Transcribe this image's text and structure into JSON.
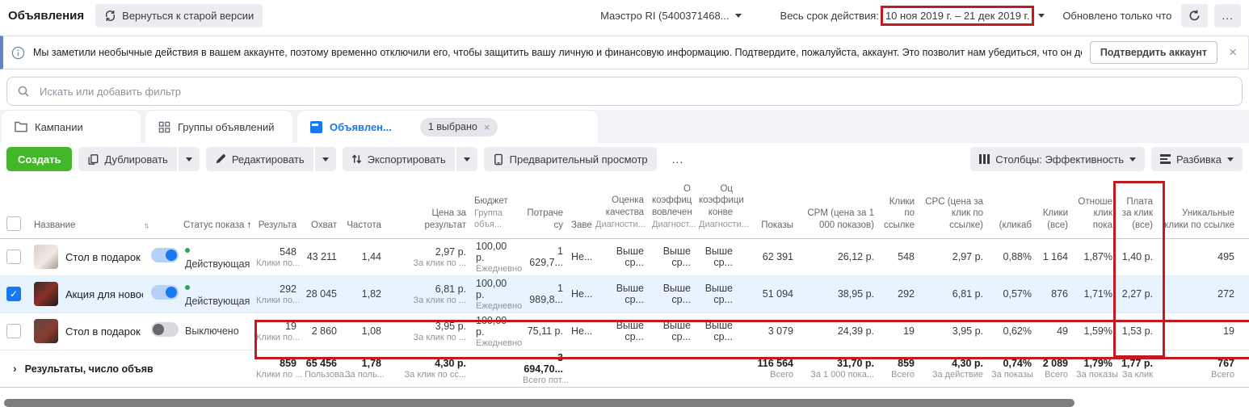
{
  "page": {
    "title": "Объявления",
    "back_button": "Вернуться к старой версии",
    "account": "Маэстро RI (5400371468...",
    "date_label": "Весь срок действия:",
    "date_range": "10 ноя 2019 г. – 21 дек 2019 г.",
    "updated": "Обновлено только что"
  },
  "banner": {
    "text": "Мы заметили необычные действия в вашем аккаунте, поэтому временно отключили его, чтобы защитить вашу личную и финансовую информацию. Подтвердите, пожалуйста, аккаунт. Это позволит нам убедиться, что он действительно принадлежит вам.",
    "confirm_button": "Подтвердить аккаунт"
  },
  "search": {
    "placeholder": "Искать или добавить фильтр"
  },
  "tabs": {
    "campaigns": "Кампании",
    "adsets": "Группы объявлений",
    "ads": "Объявлен...",
    "selected_badge": "1 выбрано"
  },
  "toolbar": {
    "create": "Создать",
    "duplicate": "Дублировать",
    "edit": "Редактировать",
    "export": "Экспортировать",
    "preview": "Предварительный просмотр",
    "columns": "Столбцы: Эффективность",
    "breakdown": "Разбивка"
  },
  "icons": {
    "dots": "...",
    "close": "×",
    "chevron": "›",
    "sort": "↑↓",
    "arrow_up": "↑",
    "check": "✓"
  },
  "colors": {
    "accent_blue": "#1877f2",
    "green": "#42b72a",
    "annotation_red": "#c41a1f",
    "selected_row": "#e7f3ff",
    "status_green": "#31a24c"
  },
  "table": {
    "name_header": "Название",
    "status_header": "Статус показа",
    "columns": [
      {
        "key": "results",
        "label": "Результа"
      },
      {
        "key": "reach",
        "label": "Охват"
      },
      {
        "key": "frequency",
        "label": "Частота"
      },
      {
        "key": "cost_per_result",
        "label": "Цена за результат"
      },
      {
        "key": "budget",
        "label": "Бюджет",
        "sub": "Группа объя...",
        "align": "left"
      },
      {
        "key": "spent",
        "label": "Потраче су"
      },
      {
        "key": "ends",
        "label": "Заве"
      },
      {
        "key": "quality",
        "label": "Оценка качества",
        "sub": "Диагности..."
      },
      {
        "key": "engagement_rate",
        "label": "О коэффиц вовлечен",
        "sub": "Диагност..."
      },
      {
        "key": "conversion_rate",
        "label": "Оц коэффици конве",
        "sub": "Диагности..."
      },
      {
        "key": "impressions",
        "label": "Показы"
      },
      {
        "key": "cpm",
        "label": "CPM (цена за 1 000 показов)"
      },
      {
        "key": "link_clicks",
        "label": "Клики по ссылке"
      },
      {
        "key": "cpc",
        "label": "CPC (цена за клик по ссылке)"
      },
      {
        "key": "ctr",
        "label": "(кликаб"
      },
      {
        "key": "clicks_all",
        "label": "Клики (все)"
      },
      {
        "key": "click_ratio",
        "label": "Отноше клик пока"
      },
      {
        "key": "pay_per_click",
        "label": "Плата за клик (все)"
      },
      {
        "key": "unique_link_clicks",
        "label": "Уникальные клики по ссылке"
      }
    ],
    "rows": [
      {
        "name": "Стол в подарок — Ко...",
        "selected": false,
        "toggle_on": true,
        "status": "Действующая",
        "status_active": true,
        "cells": {
          "results": {
            "v": "548",
            "s": "Клики по..."
          },
          "reach": {
            "v": "43 211"
          },
          "frequency": {
            "v": "1,44"
          },
          "cost_per_result": {
            "v": "2,97 р.",
            "s": "За клик по ..."
          },
          "budget": {
            "v": "100,00 р.",
            "s": "Ежедневно"
          },
          "spent": {
            "v": "1 629,7..."
          },
          "ends": {
            "v": "Не..."
          },
          "quality": {
            "v": "Выше ср..."
          },
          "engagement_rate": {
            "v": "Выше ср..."
          },
          "conversion_rate": {
            "v": "Выше ср..."
          },
          "impressions": {
            "v": "62 391"
          },
          "cpm": {
            "v": "26,12 р."
          },
          "link_clicks": {
            "v": "548"
          },
          "cpc": {
            "v": "2,97 р."
          },
          "ctr": {
            "v": "0,88%"
          },
          "clicks_all": {
            "v": "1 164"
          },
          "click_ratio": {
            "v": "1,87%"
          },
          "pay_per_click": {
            "v": "1,40 р."
          },
          "unique_link_clicks": {
            "v": "495"
          }
        }
      },
      {
        "name": "Акция для новосел...",
        "selected": true,
        "toggle_on": true,
        "status": "Действующая",
        "status_active": true,
        "cells": {
          "results": {
            "v": "292",
            "s": "Клики по..."
          },
          "reach": {
            "v": "28 045"
          },
          "frequency": {
            "v": "1,82"
          },
          "cost_per_result": {
            "v": "6,81 р.",
            "s": "За клик по ..."
          },
          "budget": {
            "v": "100,00 р.",
            "s": "Ежедневно"
          },
          "spent": {
            "v": "1 989,8..."
          },
          "ends": {
            "v": "Не..."
          },
          "quality": {
            "v": "Выше ср..."
          },
          "engagement_rate": {
            "v": "Выше ср..."
          },
          "conversion_rate": {
            "v": "Выше ср..."
          },
          "impressions": {
            "v": "51 094"
          },
          "cpm": {
            "v": "38,95 р."
          },
          "link_clicks": {
            "v": "292"
          },
          "cpc": {
            "v": "6,81 р."
          },
          "ctr": {
            "v": "0,57%"
          },
          "clicks_all": {
            "v": "876"
          },
          "click_ratio": {
            "v": "1,71%"
          },
          "pay_per_click": {
            "v": "2,27 р."
          },
          "unique_link_clicks": {
            "v": "272"
          }
        }
      },
      {
        "name": "Стол в подарок",
        "selected": false,
        "toggle_on": false,
        "status": "Выключено",
        "status_active": false,
        "cells": {
          "results": {
            "v": "19",
            "s": "Клики по..."
          },
          "reach": {
            "v": "2 860"
          },
          "frequency": {
            "v": "1,08"
          },
          "cost_per_result": {
            "v": "3,95 р.",
            "s": "За клик по ..."
          },
          "budget": {
            "v": "100,00 р.",
            "s": "Ежедневно"
          },
          "spent": {
            "v": "75,11 р."
          },
          "ends": {
            "v": "Не..."
          },
          "quality": {
            "v": "Выше ср..."
          },
          "engagement_rate": {
            "v": "Выше ср..."
          },
          "conversion_rate": {
            "v": "Выше ср..."
          },
          "impressions": {
            "v": "3 079"
          },
          "cpm": {
            "v": "24,39 р."
          },
          "link_clicks": {
            "v": "19"
          },
          "cpc": {
            "v": "3,95 р."
          },
          "ctr": {
            "v": "0,62%"
          },
          "clicks_all": {
            "v": "49"
          },
          "click_ratio": {
            "v": "1,59%"
          },
          "pay_per_click": {
            "v": "1,53 р."
          },
          "unique_link_clicks": {
            "v": "19"
          }
        }
      }
    ],
    "footer": {
      "label": "Результаты, число объяв",
      "cells": {
        "results": {
          "v": "859",
          "s": "Клики по ..."
        },
        "reach": {
          "v": "65 456",
          "s": "Пользова..."
        },
        "frequency": {
          "v": "1,78",
          "s": "За поль..."
        },
        "cost_per_result": {
          "v": "4,30 р.",
          "s": "За клик по сс..."
        },
        "spent": {
          "v": "3 694,70...",
          "s": "Всего пот..."
        },
        "impressions": {
          "v": "116 564",
          "s": "Всего"
        },
        "cpm": {
          "v": "31,70 р.",
          "s": "За 1 000 пока..."
        },
        "link_clicks": {
          "v": "859",
          "s": "Всего"
        },
        "cpc": {
          "v": "4,30 р.",
          "s": "За действие"
        },
        "ctr": {
          "v": "0,74%",
          "s": "За показы"
        },
        "clicks_all": {
          "v": "2 089",
          "s": "Всего"
        },
        "click_ratio": {
          "v": "1,79%",
          "s": "За показы"
        },
        "pay_per_click": {
          "v": "1,77 р.",
          "s": "За клик"
        },
        "unique_link_clicks": {
          "v": "767",
          "s": "Всего"
        }
      }
    }
  }
}
